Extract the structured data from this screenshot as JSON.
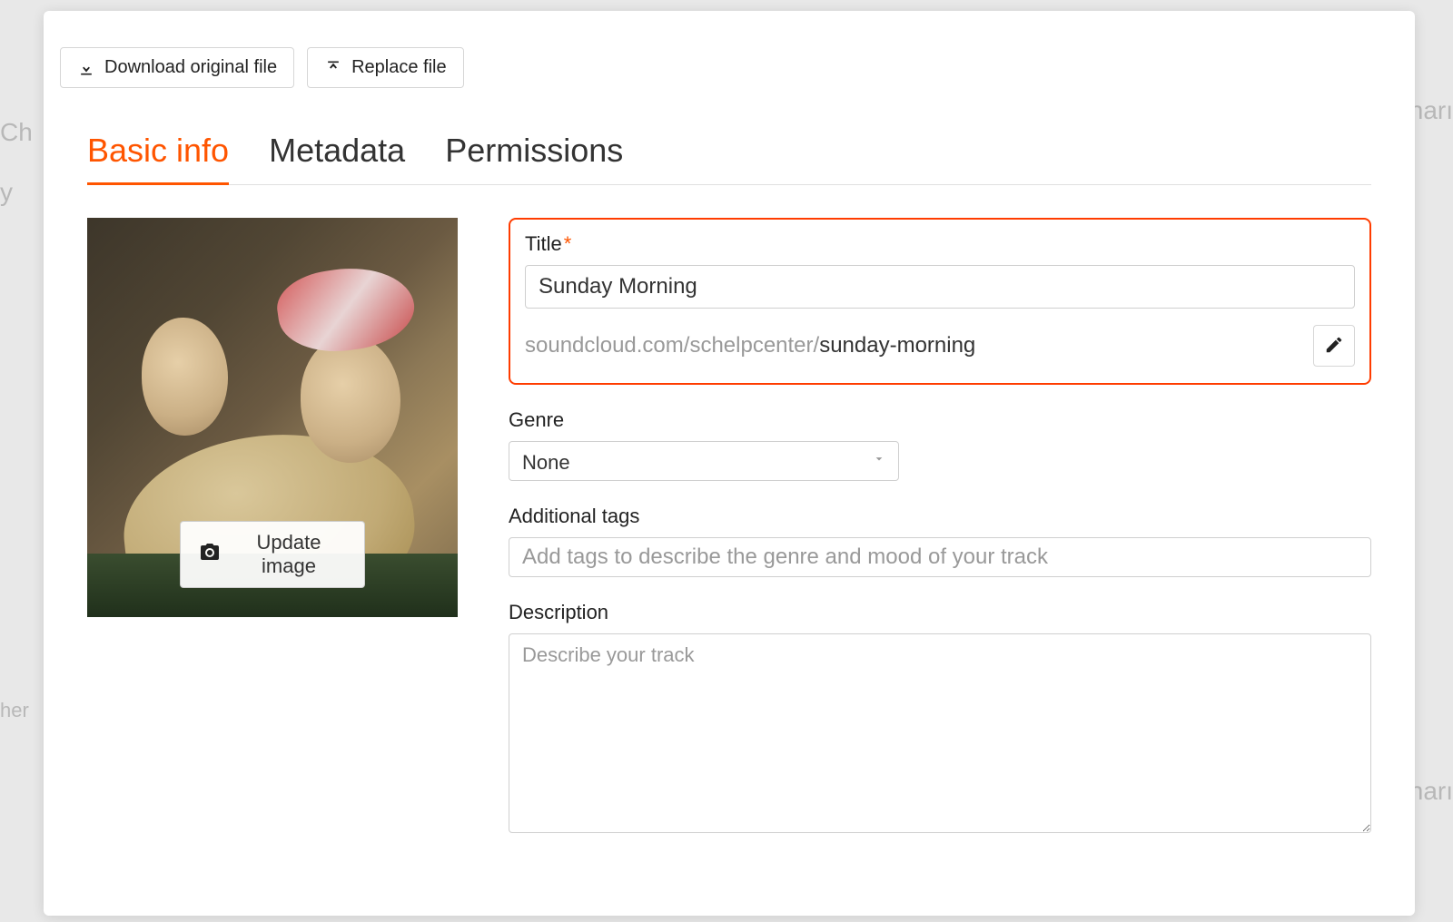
{
  "background": {
    "text1": "Ch",
    "text2": "y",
    "text3": "harı",
    "text4": "harı",
    "text5": "her"
  },
  "top_actions": {
    "download_label": "Download original file",
    "replace_label": "Replace file"
  },
  "tabs": {
    "basic": "Basic info",
    "metadata": "Metadata",
    "permissions": "Permissions"
  },
  "image": {
    "update_label": "Update image"
  },
  "form": {
    "title_label": "Title",
    "title_value": "Sunday Morning",
    "permalink_base": "soundcloud.com/schelpcenter/",
    "permalink_slug": "sunday-morning",
    "genre_label": "Genre",
    "genre_value": "None",
    "tags_label": "Additional tags",
    "tags_placeholder": "Add tags to describe the genre and mood of your track",
    "description_label": "Description",
    "description_placeholder": "Describe your track"
  }
}
